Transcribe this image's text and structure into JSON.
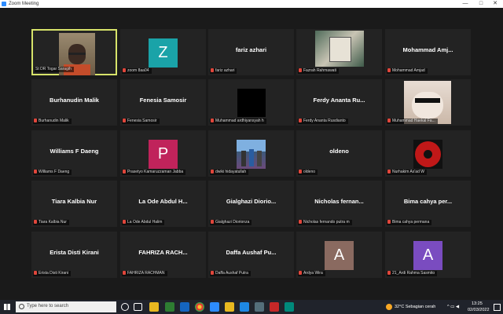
{
  "window": {
    "title": "Zoom Meeting"
  },
  "window_controls": {
    "minimize": "—",
    "maximize": "□",
    "close": "✕"
  },
  "tiles": [
    {
      "big": "",
      "label": "St DR Togar Saragih",
      "avatar": ""
    },
    {
      "big": "",
      "label": "zoom 8aa04",
      "avatar": "Z"
    },
    {
      "big": "fariz azhari",
      "label": "fariz azhari",
      "avatar": ""
    },
    {
      "big": "",
      "label": "Fazrah Rahmawati",
      "avatar": ""
    },
    {
      "big": "Mohammad Amj...",
      "label": "Mohammad Amjad",
      "avatar": ""
    },
    {
      "big": "Burhanudin Malik",
      "label": "Burhanudin Malik",
      "avatar": ""
    },
    {
      "big": "Fenesia Samosir",
      "label": "Fenesia Samosir",
      "avatar": ""
    },
    {
      "big": "",
      "label": "Muhammad ardhiyansyah h",
      "avatar": ""
    },
    {
      "big": "Ferdy Ananta Ru...",
      "label": "Ferdy Ananta Rusdianto",
      "avatar": ""
    },
    {
      "big": "",
      "label": "Muhammad Haekal Fa...",
      "avatar": ""
    },
    {
      "big": "Williams F Daeng",
      "label": "Williams F Daeng",
      "avatar": ""
    },
    {
      "big": "",
      "label": "Prasetyo Kamaruzzaman Jabba",
      "avatar": "P"
    },
    {
      "big": "",
      "label": "dwiki hidayatullah",
      "avatar": ""
    },
    {
      "big": "oldeno",
      "label": "oldeno",
      "avatar": ""
    },
    {
      "big": "",
      "label": "Nurhakim As'ad W",
      "avatar": ""
    },
    {
      "big": "Tiara Kalbia Nur",
      "label": "Tiara Kalbia Nur",
      "avatar": ""
    },
    {
      "big": "La Ode Abdul H...",
      "label": "La Ode Abdul Halim",
      "avatar": ""
    },
    {
      "big": "Gialghazi Diorio...",
      "label": "Gialghazi Diorionza",
      "avatar": ""
    },
    {
      "big": "Nicholas fernan...",
      "label": "Nicholas fernando putra m",
      "avatar": ""
    },
    {
      "big": "Bima cahya per...",
      "label": "Bima cahya permana",
      "avatar": ""
    },
    {
      "big": "Erista Disti Kirani",
      "label": "Erista Disti Kirani",
      "avatar": ""
    },
    {
      "big": "FAHRIZA RACH...",
      "label": "FAHRIZA RACHMAN",
      "avatar": ""
    },
    {
      "big": "Daffa Aushaf Pu...",
      "label": "Daffa Aushaf Putra",
      "avatar": ""
    },
    {
      "big": "",
      "label": "Ardya Wira",
      "avatar": "A"
    },
    {
      "big": "",
      "label": "21_Ardi Rahma Sasmito",
      "avatar": "A"
    }
  ],
  "taskbar": {
    "search_placeholder": "Type here to search",
    "weather": "32°C  Sebagian cerah",
    "time": "13:25",
    "date": "02/03/2022"
  },
  "colors": {
    "active_border": "#d7e36a",
    "avatar_z": "#1aa3a8",
    "avatar_p": "#c0235b",
    "avatar_a1": "#8a6a60",
    "avatar_a2": "#7a4cc0"
  }
}
